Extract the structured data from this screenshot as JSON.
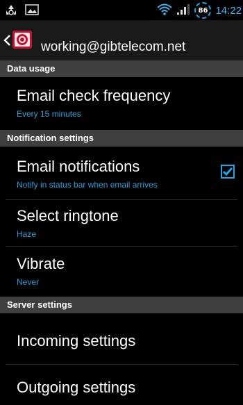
{
  "status_bar": {
    "battery": "86",
    "time": "14:22",
    "left_icons": [
      "recycle-icon",
      "picture-icon"
    ],
    "right_icons": [
      "wifi-icon",
      "signal-icon"
    ]
  },
  "action_bar": {
    "title": "working@gibtelecom.net",
    "back_icon": "chevron-left-icon",
    "app_icon": "email-app-icon"
  },
  "sections": {
    "data_usage": {
      "header": "Data usage"
    },
    "notification": {
      "header": "Notification settings"
    },
    "server": {
      "header": "Server settings"
    }
  },
  "prefs": {
    "email_check_frequency": {
      "title": "Email check frequency",
      "summary": "Every 15 minutes"
    },
    "email_notifications": {
      "title": "Email notifications",
      "summary": "Notify in status bar when email arrives",
      "checked": true
    },
    "select_ringtone": {
      "title": "Select ringtone",
      "summary": "Haze"
    },
    "vibrate": {
      "title": "Vibrate",
      "summary": "Never"
    },
    "incoming_settings": {
      "title": "Incoming settings"
    },
    "outgoing_settings": {
      "title": "Outgoing settings"
    }
  },
  "colors": {
    "accent": "#1fa7e8",
    "summary": "#2a9fd8",
    "section_bg": "#3f3f3f",
    "background": "#000000"
  }
}
